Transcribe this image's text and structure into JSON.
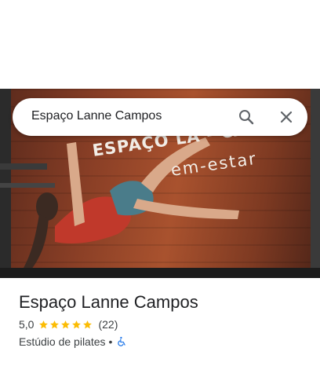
{
  "search": {
    "value": "Espaço Lanne Campos"
  },
  "photo": {
    "sign_line1": "ESPAÇO LA   - CAMPOS",
    "sign_line2": "em-estar"
  },
  "place": {
    "title": "Espaço Lanne Campos",
    "rating": 5.0,
    "rating_label": "5,0",
    "stars_filled": 5,
    "reviews_label": "(22)",
    "category": "Estúdio de pilates",
    "separator": "•",
    "accessibility_icon": "wheelchair-accessible-icon"
  },
  "colors": {
    "star": "#FBBC04",
    "accessibility": "#1A73E8",
    "text_primary": "#202124",
    "text_secondary": "#3C4043"
  }
}
